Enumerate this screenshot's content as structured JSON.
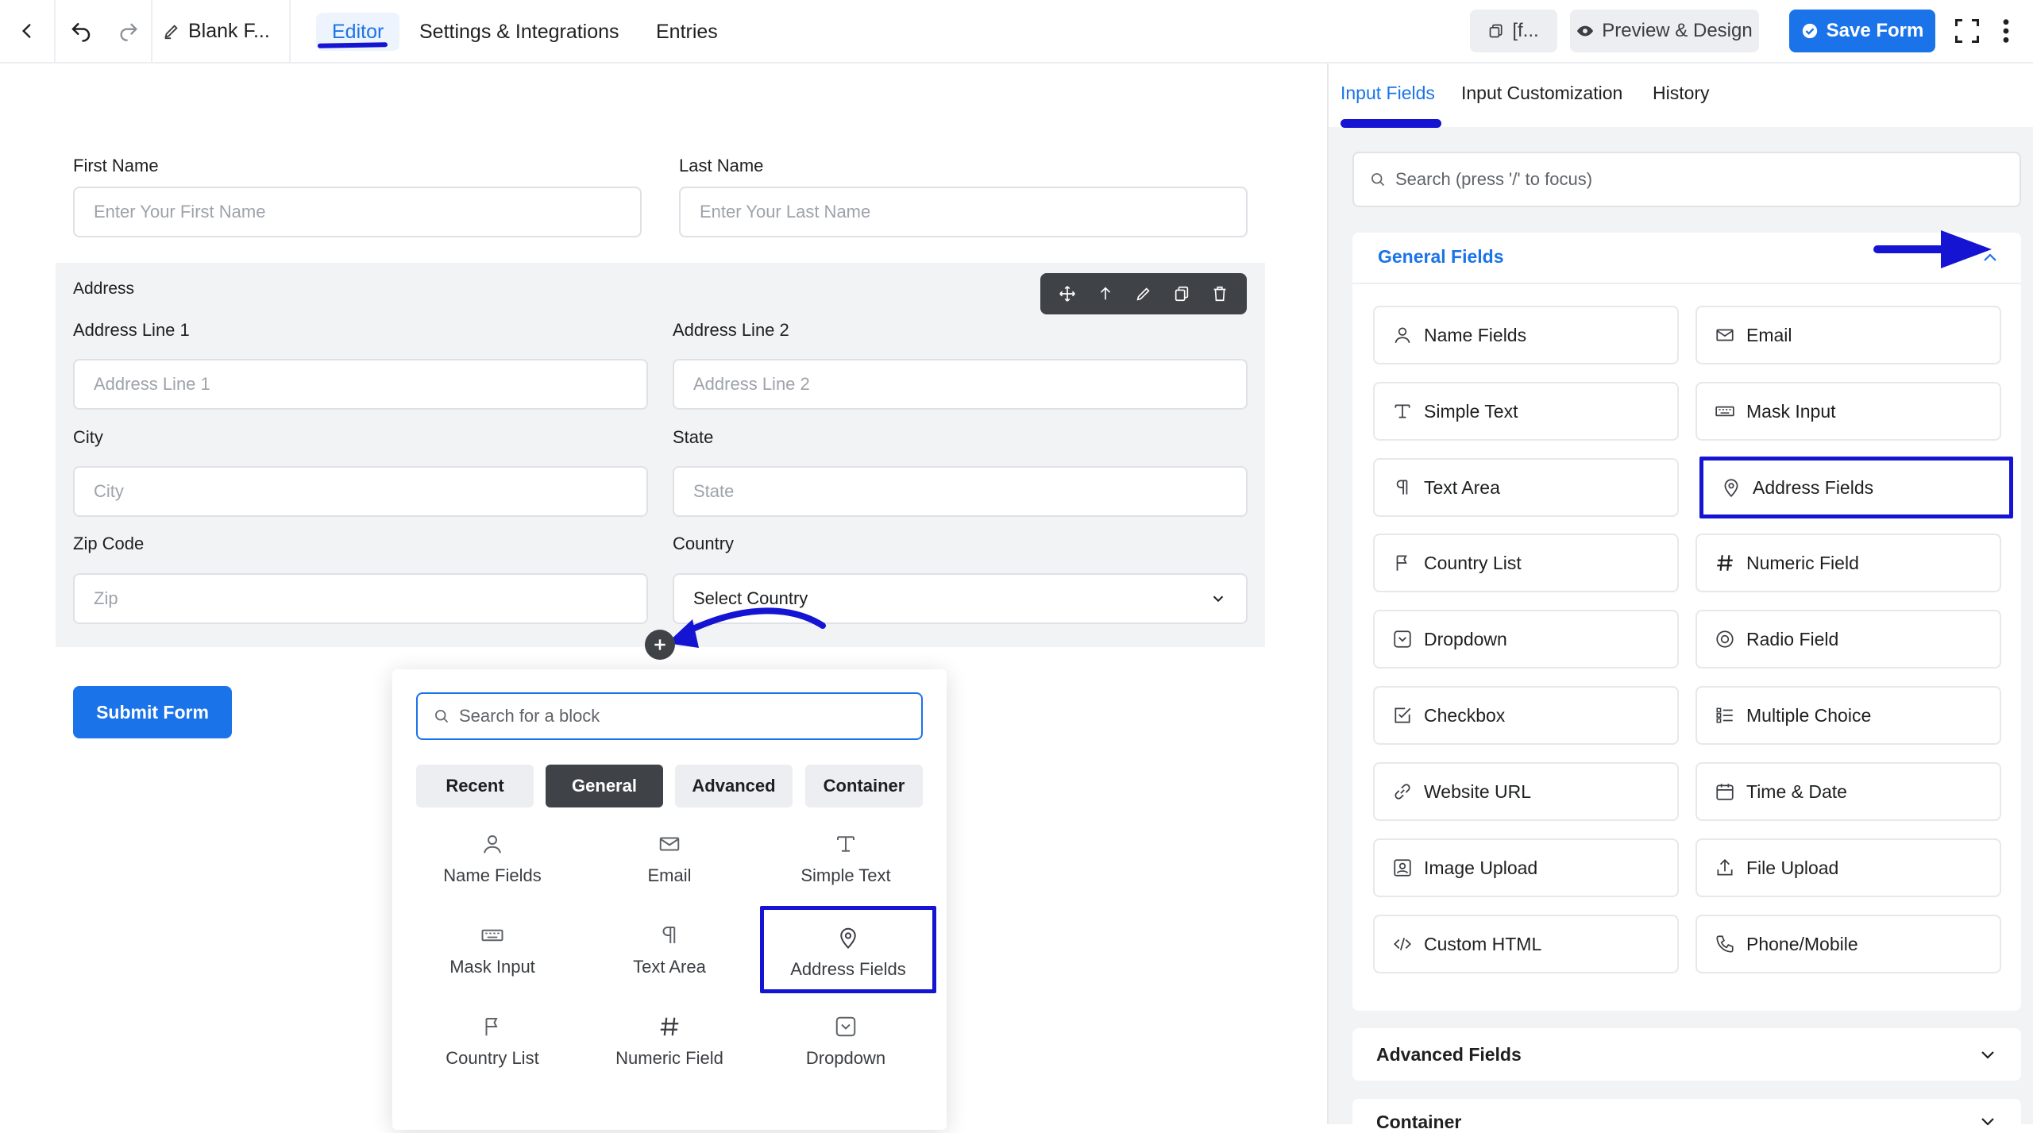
{
  "topbar": {
    "form_title": "Blank F...",
    "tabs": [
      "Editor",
      "Settings & Integrations",
      "Entries"
    ],
    "shortcode_label": "[f...",
    "preview_label": "Preview & Design",
    "save_label": "Save Form"
  },
  "form": {
    "first_name": {
      "label": "First Name",
      "placeholder": "Enter Your First Name"
    },
    "last_name": {
      "label": "Last Name",
      "placeholder": "Enter Your Last Name"
    },
    "address": {
      "title": "Address",
      "line1": {
        "label": "Address Line 1",
        "placeholder": "Address Line 1"
      },
      "line2": {
        "label": "Address Line 2",
        "placeholder": "Address Line 2"
      },
      "city": {
        "label": "City",
        "placeholder": "City"
      },
      "state": {
        "label": "State",
        "placeholder": "State"
      },
      "zip": {
        "label": "Zip Code",
        "placeholder": "Zip"
      },
      "country": {
        "label": "Country",
        "value": "Select Country"
      }
    },
    "submit_label": "Submit Form"
  },
  "inserter": {
    "search_placeholder": "Search for a block",
    "tabs": [
      "Recent",
      "General",
      "Advanced",
      "Container"
    ],
    "active_tab": "General",
    "items": [
      {
        "label": "Name Fields",
        "icon": "user-icon"
      },
      {
        "label": "Email",
        "icon": "envelope-icon"
      },
      {
        "label": "Simple Text",
        "icon": "text-cursor-icon"
      },
      {
        "label": "Mask Input",
        "icon": "keyboard-icon"
      },
      {
        "label": "Text Area",
        "icon": "paragraph-icon"
      },
      {
        "label": "Address Fields",
        "icon": "map-pin-icon"
      },
      {
        "label": "Country List",
        "icon": "flag-icon"
      },
      {
        "label": "Numeric Field",
        "icon": "hash-icon"
      },
      {
        "label": "Dropdown",
        "icon": "dropdown-icon"
      }
    ]
  },
  "panel": {
    "tabs": [
      "Input Fields",
      "Input Customization",
      "History"
    ],
    "active_tab": "Input Fields",
    "search_placeholder": "Search (press '/' to focus)",
    "general_title": "General Fields",
    "general_fields": [
      {
        "label": "Name Fields",
        "icon": "user-icon"
      },
      {
        "label": "Email",
        "icon": "envelope-icon"
      },
      {
        "label": "Simple Text",
        "icon": "text-cursor-icon"
      },
      {
        "label": "Mask Input",
        "icon": "keyboard-icon"
      },
      {
        "label": "Text Area",
        "icon": "paragraph-icon"
      },
      {
        "label": "Address Fields",
        "icon": "map-pin-icon"
      },
      {
        "label": "Country List",
        "icon": "flag-icon"
      },
      {
        "label": "Numeric Field",
        "icon": "hash-icon"
      },
      {
        "label": "Dropdown",
        "icon": "dropdown-icon"
      },
      {
        "label": "Radio Field",
        "icon": "radio-icon"
      },
      {
        "label": "Checkbox",
        "icon": "checkbox-icon"
      },
      {
        "label": "Multiple Choice",
        "icon": "list-check-icon"
      },
      {
        "label": "Website URL",
        "icon": "link-icon"
      },
      {
        "label": "Time & Date",
        "icon": "calendar-icon"
      },
      {
        "label": "Image Upload",
        "icon": "image-icon"
      },
      {
        "label": "File Upload",
        "icon": "upload-icon"
      },
      {
        "label": "Custom HTML",
        "icon": "code-icon"
      },
      {
        "label": "Phone/Mobile",
        "icon": "phone-icon"
      }
    ],
    "advanced_title": "Advanced Fields",
    "container_title": "Container"
  },
  "colors": {
    "accent": "#1a73e8",
    "annotation": "#1414d2",
    "dark": "#3f4347"
  }
}
